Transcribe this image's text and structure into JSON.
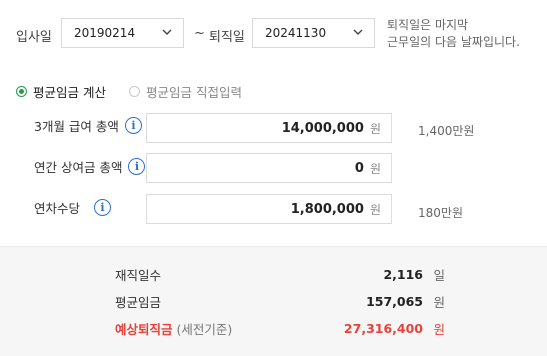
{
  "dates": {
    "hire_label": "입사일",
    "hire_value": "20190214",
    "separator": "~",
    "leave_label": "퇴직일",
    "leave_value": "20241130",
    "note_line1": "퇴직일은 마지막",
    "note_line2": "근무일의 다음 날짜입니다."
  },
  "mode": {
    "option_calc": "평균임금 계산",
    "option_direct": "평균임금 직접입력",
    "selected": "option_calc"
  },
  "inputs": {
    "salary": {
      "label": "3개월 급여 총액",
      "value": "14,000,000",
      "unit": "원",
      "hint": "1,400만원"
    },
    "bonus": {
      "label": "연간 상여금 총액",
      "value": "0",
      "unit": "원",
      "hint": ""
    },
    "leave_pay": {
      "label": "연차수당",
      "value": "1,800,000",
      "unit": "원",
      "hint": "180만원"
    }
  },
  "summary": {
    "days_label": "재직일수",
    "days_value": "2,116",
    "days_unit": "일",
    "avg_label": "평균임금",
    "avg_value": "157,065",
    "avg_unit": "원",
    "sev_label": "예상퇴직금",
    "sev_sub": "(세전기준)",
    "sev_value": "27,316,400",
    "sev_unit": "원"
  },
  "colors": {
    "accent_green": "#1e9e48",
    "info_blue": "#2d6fd2",
    "result_red": "#e8413a"
  }
}
